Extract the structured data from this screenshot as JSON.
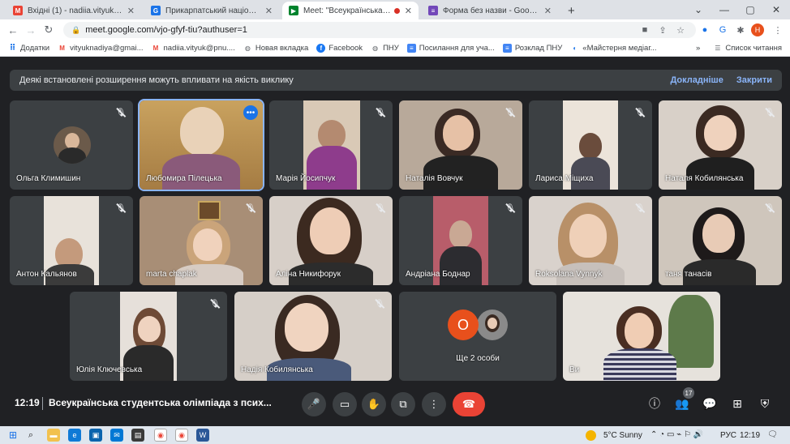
{
  "browser": {
    "tabs": [
      {
        "title": "Вхідні (1) - nadiia.vityuk@pnu.ed",
        "icon": "gmail-icon",
        "color": "#ea4335"
      },
      {
        "title": "Прикарпатський національний",
        "icon": "site-icon",
        "color": "#1a73e8"
      },
      {
        "title": "Meet: \"Всеукраїнська студ",
        "icon": "meet-icon",
        "color": "#00832d"
      },
      {
        "title": "Форма без назви - Google Фор",
        "icon": "forms-icon",
        "color": "#7248b9"
      }
    ],
    "new_tab": "+",
    "url": "meet.google.com/vjo-gfyf-tiu?authuser=1",
    "profile_initial": "Н",
    "bookmarks": [
      {
        "label": "Додатки",
        "icon": "apps-icon"
      },
      {
        "label": "vityuknadiya@gmai...",
        "icon": "gmail-icon"
      },
      {
        "label": "nadiia.vityuk@pnu....",
        "icon": "gmail-icon"
      },
      {
        "label": "Новая вкладка",
        "icon": "globe-icon"
      },
      {
        "label": "Facebook",
        "icon": "facebook-icon"
      },
      {
        "label": "ПНУ",
        "icon": "globe-icon"
      },
      {
        "label": "Посилання для уча...",
        "icon": "doc-icon"
      },
      {
        "label": "Розклад ПНУ",
        "icon": "doc-icon"
      },
      {
        "label": "«Майстерня медіаг...",
        "icon": "site-icon"
      }
    ],
    "reading_list": "Список читання"
  },
  "banner": {
    "text": "Деякі встановлені розширення можуть впливати на якість виклику",
    "details": "Докладніше",
    "close": "Закрити"
  },
  "participants": [
    {
      "name": "Ольга Климишин",
      "type": "avatar"
    },
    {
      "name": "Любомира Пілецька",
      "type": "video"
    },
    {
      "name": "Марія Йосипчук",
      "type": "video"
    },
    {
      "name": "Наталія Вовчук",
      "type": "video"
    },
    {
      "name": "Лариса Міщиха",
      "type": "video"
    },
    {
      "name": "Наталя Кобилянська",
      "type": "video"
    },
    {
      "name": "Антон Кальянов",
      "type": "video"
    },
    {
      "name": "marta chaplak",
      "type": "video"
    },
    {
      "name": "Аліна Никифорук",
      "type": "video"
    },
    {
      "name": "Андріана Боднар",
      "type": "video"
    },
    {
      "name": "Roksolana Vynnyk",
      "type": "video"
    },
    {
      "name": "таня танасів",
      "type": "video"
    },
    {
      "name": "Юлія Ключевська",
      "type": "video"
    },
    {
      "name": "Надія Кобилянська",
      "type": "video"
    },
    {
      "name": "Ще 2 особи",
      "type": "overflow",
      "initial": "О"
    },
    {
      "name": "Ви",
      "type": "video"
    }
  ],
  "meeting": {
    "time": "12:19",
    "title": "Всеукраїнська студентська олімпіада з псих...",
    "people_count": "17"
  },
  "taskbar": {
    "weather": "5°C  Sunny",
    "lang": "РУС",
    "time": "12:19"
  },
  "colors": {
    "meet_bg": "#202124",
    "tile_bg": "#3c4043",
    "end_call": "#ea4335",
    "link": "#8ab4f8"
  }
}
